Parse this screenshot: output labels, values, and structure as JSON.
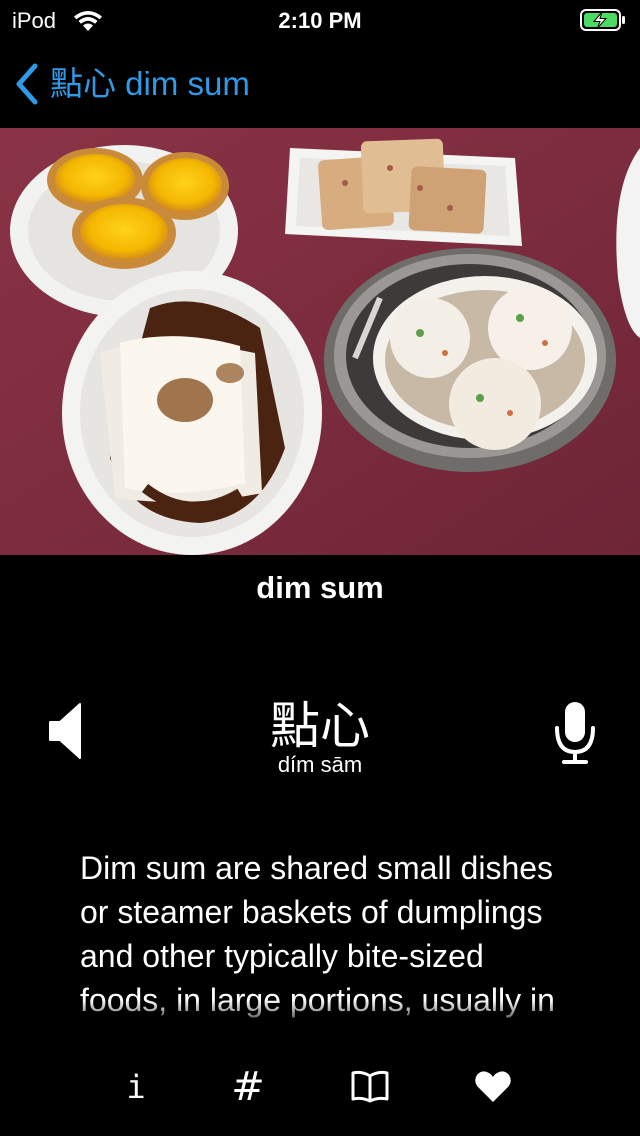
{
  "status_bar": {
    "carrier": "iPod",
    "time": "2:10 PM",
    "wifi_icon": "wifi-icon",
    "battery_icon": "battery-charging-icon",
    "battery_color": "#4cd964"
  },
  "nav": {
    "back_label": "點心 dim sum",
    "back_icon": "chevron-left-icon",
    "accent_color": "#2f9be6"
  },
  "item": {
    "title": "dim sum",
    "chinese": "點心",
    "pinyin": "dím sām",
    "description": "Dim sum are shared small dishes or steamer baskets of dumplings and other typically bite-sized foods, in large portions, usually in cantonese restaurants.",
    "speaker_icon": "speaker-icon",
    "mic_icon": "microphone-icon"
  },
  "tab_bar": {
    "items": [
      {
        "icon": "info-icon",
        "glyph": "i"
      },
      {
        "icon": "hash-icon",
        "glyph": "#"
      },
      {
        "icon": "book-icon",
        "glyph": ""
      },
      {
        "icon": "heart-icon",
        "glyph": ""
      }
    ]
  }
}
